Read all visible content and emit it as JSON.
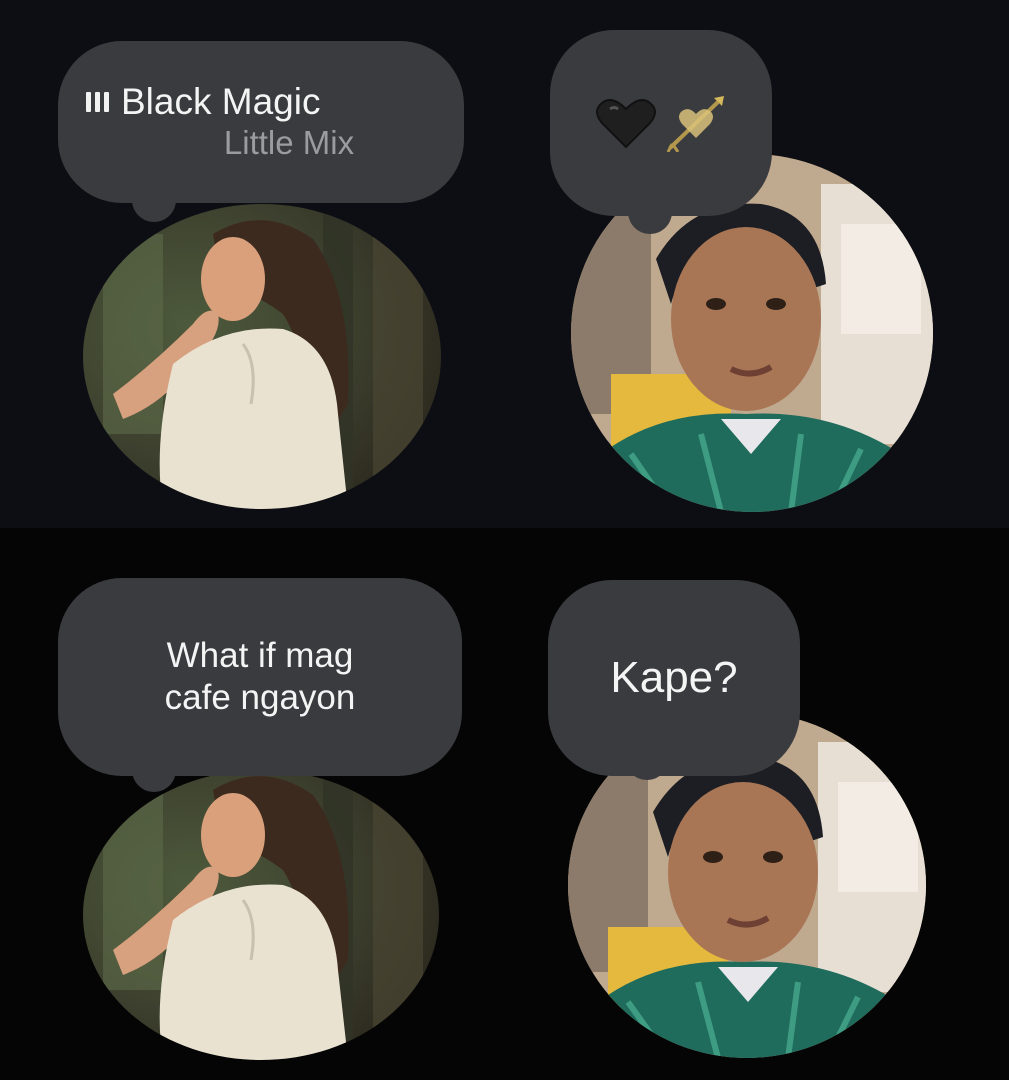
{
  "notes": [
    {
      "kind": "now_playing",
      "icon": "audio-bars-icon",
      "song_title": "Black Magic",
      "artist": "Little Mix",
      "avatar": "profile-photo-woman"
    },
    {
      "kind": "emoji",
      "emojis": [
        "black-heart-icon",
        "heart-with-arrow-icon"
      ],
      "avatar": "profile-photo-man"
    },
    {
      "kind": "text",
      "lines": [
        "What if mag",
        "cafe ngayon"
      ],
      "avatar": "profile-photo-woman"
    },
    {
      "kind": "text",
      "text": "Kape?",
      "avatar": "profile-photo-man"
    }
  ],
  "colors": {
    "top_background": "#0c0e14",
    "bottom_background": "#050505",
    "bubble": "#3a3b3f",
    "primary_text": "#f4f4f4",
    "secondary_text": "#9b9ca0"
  }
}
